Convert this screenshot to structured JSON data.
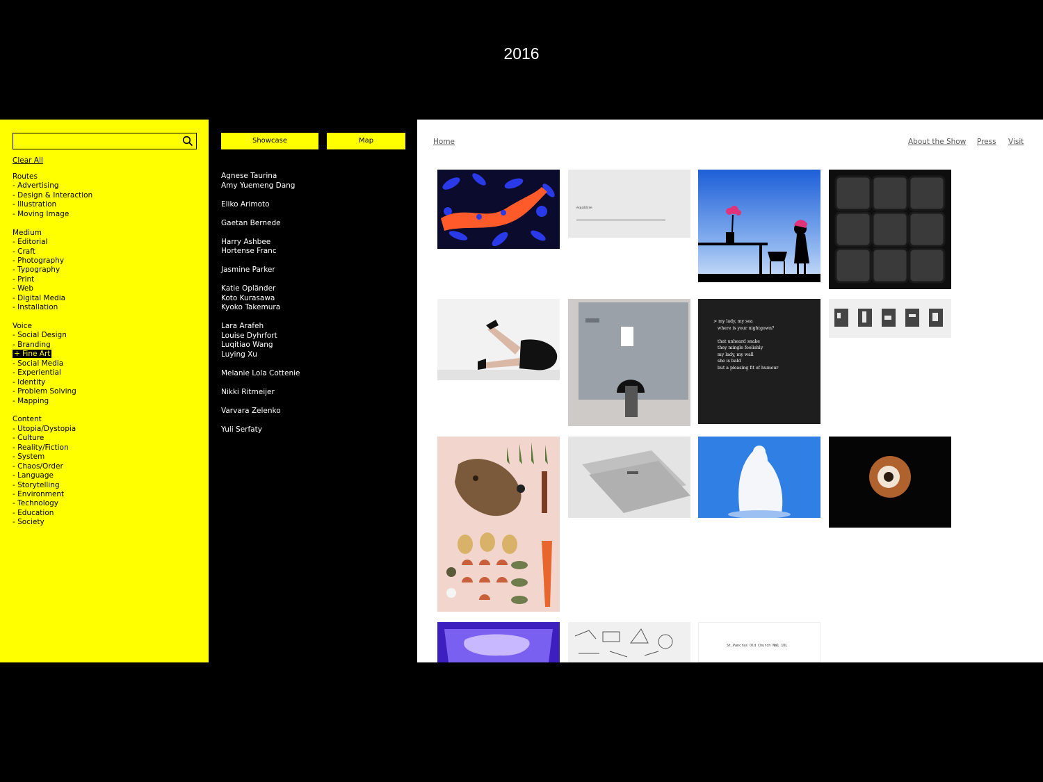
{
  "slide_title": "2016",
  "search": {
    "placeholder": "",
    "value": ""
  },
  "clear_all": "Clear All",
  "filters": [
    {
      "title": "Routes",
      "items": [
        "- Advertising",
        "- Design & Interaction",
        "- Illustration",
        "- Moving Image"
      ]
    },
    {
      "title": "Medium",
      "items": [
        "- Editorial",
        "- Craft",
        "- Photography",
        "- Typography",
        "- Print",
        "- Web",
        "- Digital Media",
        "- Installation"
      ]
    },
    {
      "title": "Voice",
      "items": [
        "- Social Design",
        "- Branding",
        "+ Fine Art",
        "- Social Media",
        "- Experiential",
        "- Identity",
        "- Problem Solving",
        "- Mapping"
      ]
    },
    {
      "title": "Content",
      "items": [
        "- Utopia/Dystopia",
        "- Culture",
        "- Reality/Fiction",
        "- System",
        "- Chaos/Order",
        "- Language",
        "- Storytelling",
        "- Environment",
        "- Technology",
        "- Education",
        "- Society"
      ]
    }
  ],
  "active_filter": "+ Fine Art",
  "buttons": {
    "showcase": "Showcase",
    "map": "Map"
  },
  "name_groups": [
    [
      "Agnese Taurina",
      "Amy Yuemeng Dang"
    ],
    [
      "Eliko Arimoto"
    ],
    [
      "Gaetan Bernede"
    ],
    [
      "Harry Ashbee",
      "Hortense Franc"
    ],
    [
      "Jasmine Parker"
    ],
    [
      "Katie Opländer",
      "Koto Kurasawa",
      "Kyoko Takemura"
    ],
    [
      "Lara Arafeh",
      "Louise Dyhrfort",
      "Luqitiao Wang",
      "Luying Xu"
    ],
    [
      "Melanie Lola Cottenie"
    ],
    [
      "Nikki Ritmeijer"
    ],
    [
      "Varvara Zelenko"
    ],
    [
      "Yuli Serfaty"
    ]
  ],
  "nav": {
    "home": "Home",
    "about": "About the Show",
    "press": "Press",
    "visit": "Visit"
  },
  "tiles": {
    "equilibre_title": "équilibre",
    "poem": [
      "> my lady, my sea",
      "   where is your nightgown?",
      "",
      "   that unheard snake",
      "   they mingle foolishly",
      "   my lady, my wall",
      "   she is bald",
      "   but a pleasing fit of humour"
    ],
    "church_text": "St.Pancras Old Church   NW1 1UL"
  },
  "colors": {
    "yellow": "#ffff00",
    "black": "#000000",
    "white": "#ffffff"
  }
}
